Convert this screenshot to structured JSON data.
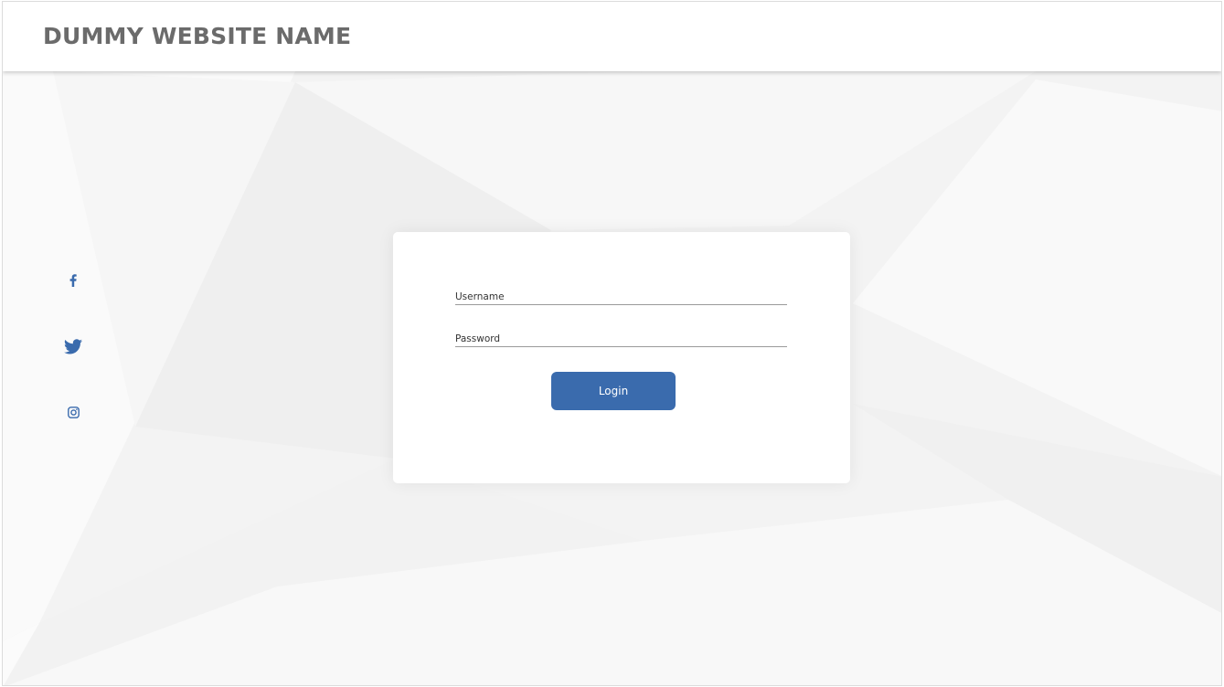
{
  "header": {
    "site_name": "DUMMY WEBSITE NAME"
  },
  "social": {
    "items": [
      {
        "name": "facebook-icon"
      },
      {
        "name": "twitter-icon"
      },
      {
        "name": "instagram-icon"
      }
    ],
    "icon_color": "#3a6bad"
  },
  "login_form": {
    "username": {
      "placeholder": "Username",
      "value": ""
    },
    "password": {
      "placeholder": "Password",
      "value": ""
    },
    "login_label": "Login"
  },
  "colors": {
    "accent": "#3a6bad",
    "site_name": "#6b6b6b",
    "background": "#f4f4f4",
    "card": "#ffffff"
  }
}
